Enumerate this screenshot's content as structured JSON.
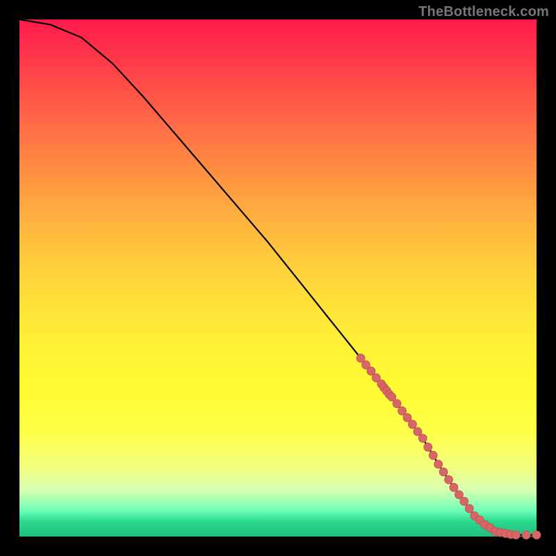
{
  "credit": "TheBottleneck.com",
  "colors": {
    "marker_fill": "#d76666",
    "marker_stroke": "#c24f4f",
    "curve": "#000000",
    "bg": "#000000"
  },
  "chart_data": {
    "type": "line",
    "title": "",
    "xlabel": "",
    "ylabel": "",
    "xlim": [
      0,
      100
    ],
    "ylim": [
      0,
      100
    ],
    "grid": false,
    "legend": false,
    "curve_x": [
      0,
      6,
      12,
      18,
      24,
      30,
      36,
      42,
      48,
      54,
      60,
      66,
      72,
      78,
      81,
      84,
      88,
      92,
      96,
      100
    ],
    "curve_y": [
      100,
      99,
      96.5,
      91.5,
      85,
      78,
      71,
      64,
      57,
      49.5,
      42,
      34.5,
      27,
      19,
      14,
      9.5,
      4,
      1,
      0.3,
      0.3
    ],
    "markers": [
      {
        "x": 66,
        "y": 34.5
      },
      {
        "x": 67,
        "y": 33.2
      },
      {
        "x": 68,
        "y": 32
      },
      {
        "x": 69,
        "y": 30.7
      },
      {
        "x": 70,
        "y": 29.5
      },
      {
        "x": 70.5,
        "y": 28.8
      },
      {
        "x": 71,
        "y": 28.2
      },
      {
        "x": 71.5,
        "y": 27.5
      },
      {
        "x": 72,
        "y": 27
      },
      {
        "x": 73,
        "y": 25.7
      },
      {
        "x": 74,
        "y": 24.3
      },
      {
        "x": 75,
        "y": 23
      },
      {
        "x": 76,
        "y": 21.7
      },
      {
        "x": 77,
        "y": 20.3
      },
      {
        "x": 78,
        "y": 19
      },
      {
        "x": 79,
        "y": 17.3
      },
      {
        "x": 80,
        "y": 15.7
      },
      {
        "x": 81,
        "y": 14
      },
      {
        "x": 82,
        "y": 12.5
      },
      {
        "x": 83,
        "y": 11
      },
      {
        "x": 84,
        "y": 9.5
      },
      {
        "x": 85,
        "y": 8.1
      },
      {
        "x": 86,
        "y": 6.8
      },
      {
        "x": 87,
        "y": 5.4
      },
      {
        "x": 88,
        "y": 4
      },
      {
        "x": 89,
        "y": 3.2
      },
      {
        "x": 90,
        "y": 2.3
      },
      {
        "x": 91,
        "y": 1.7
      },
      {
        "x": 92,
        "y": 1
      },
      {
        "x": 93,
        "y": 0.8
      },
      {
        "x": 94,
        "y": 0.6
      },
      {
        "x": 95,
        "y": 0.4
      },
      {
        "x": 96,
        "y": 0.3
      },
      {
        "x": 98,
        "y": 0.3
      },
      {
        "x": 100,
        "y": 0.3
      }
    ],
    "marker_radius_px": 6
  }
}
